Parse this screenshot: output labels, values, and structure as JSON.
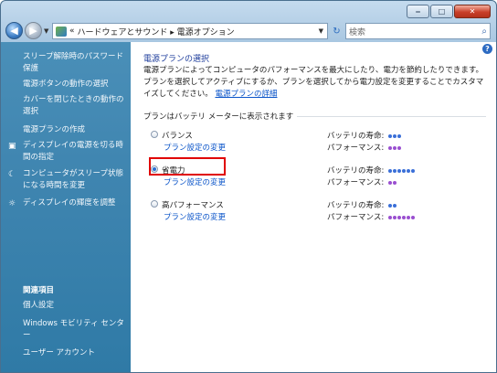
{
  "window": {
    "controls": {
      "minimize": "‒",
      "maximize": "□",
      "close": "✕"
    }
  },
  "nav": {
    "breadcrumb_prefix": "«",
    "breadcrumb": "ハードウェアとサウンド ▸ 電源オプション",
    "search_placeholder": "検索"
  },
  "sidebar": {
    "items": [
      {
        "label": "スリープ解除時のパスワード保護"
      },
      {
        "label": "電源ボタンの動作の選択"
      },
      {
        "label": "カバーを閉じたときの動作の選択"
      },
      {
        "label": "電源プランの作成"
      },
      {
        "label": "ディスプレイの電源を切る時間の指定"
      },
      {
        "label": "コンピュータがスリープ状態になる時間を変更"
      },
      {
        "label": "ディスプレイの輝度を調整"
      }
    ],
    "related_heading": "関連項目",
    "related": [
      {
        "label": "個人設定"
      },
      {
        "label": "Windows モビリティ センター"
      },
      {
        "label": "ユーザー アカウント"
      }
    ]
  },
  "main": {
    "title": "電源プランの選択",
    "description": "電源プランによってコンピュータのパフォーマンスを最大にしたり、電力を節約したりできます。プランを選択してアクティブにするか、プランを選択してから電力設定を変更することでカスタマイズしてください。",
    "details_link": "電源プランの詳細",
    "group_label": "プランはバッテリ メーターに表示されます",
    "change_link": "プラン設定の変更",
    "battery_label": "バッテリの寿命:",
    "performance_label": "パフォーマンス:",
    "plans": [
      {
        "name": "バランス",
        "selected": false,
        "battery_dots": 3,
        "performance_dots": 3
      },
      {
        "name": "省電力",
        "selected": true,
        "battery_dots": 6,
        "performance_dots": 2
      },
      {
        "name": "高パフォーマンス",
        "selected": false,
        "battery_dots": 2,
        "performance_dots": 6
      }
    ]
  },
  "colors": {
    "battery_dot": "#3a6fd8",
    "performance_dot": "#9a4fd0",
    "highlight": "#e00000"
  }
}
